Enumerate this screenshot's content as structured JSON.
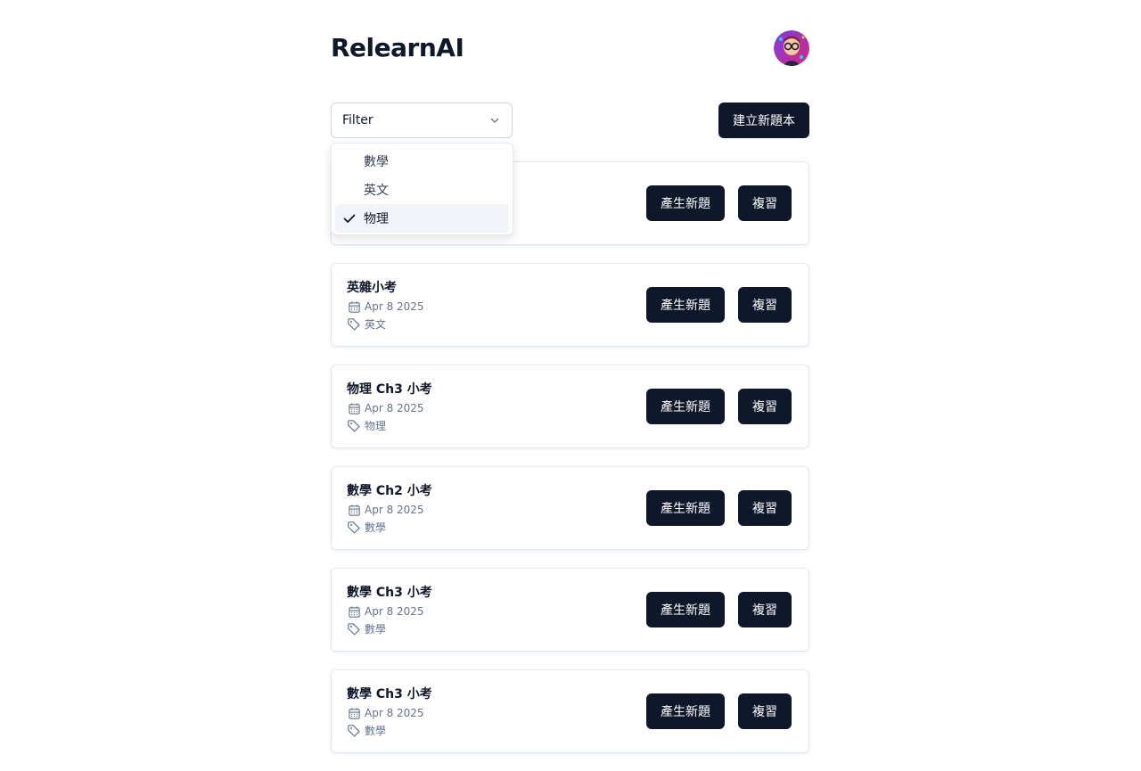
{
  "header": {
    "title": "RelearnAI",
    "avatar_icon": "avatar-icon"
  },
  "toolbar": {
    "filter_label": "Filter",
    "create_label": "建立新題本"
  },
  "dropdown": {
    "options": [
      {
        "label": "數學",
        "selected": false
      },
      {
        "label": "英文",
        "selected": false
      },
      {
        "label": "物理",
        "selected": true
      }
    ]
  },
  "buttons": {
    "generate": "產生新題",
    "review": "複習"
  },
  "cards": [
    {
      "title": "",
      "date": "",
      "tag": ""
    },
    {
      "title": "英雜小考",
      "date": "Apr 8 2025",
      "tag": "英文"
    },
    {
      "title": "物理 Ch3 小考",
      "date": "Apr 8 2025",
      "tag": "物理"
    },
    {
      "title": "數學 Ch2 小考",
      "date": "Apr 8 2025",
      "tag": "數學"
    },
    {
      "title": "數學 Ch3 小考",
      "date": "Apr 8 2025",
      "tag": "數學"
    },
    {
      "title": "數學 Ch3 小考",
      "date": "Apr 8 2025",
      "tag": "數學"
    }
  ],
  "colors": {
    "primary": "#0f172a",
    "muted_text": "#64748b",
    "border": "#e2e8f0",
    "selected_bg": "#f1f5f9"
  }
}
